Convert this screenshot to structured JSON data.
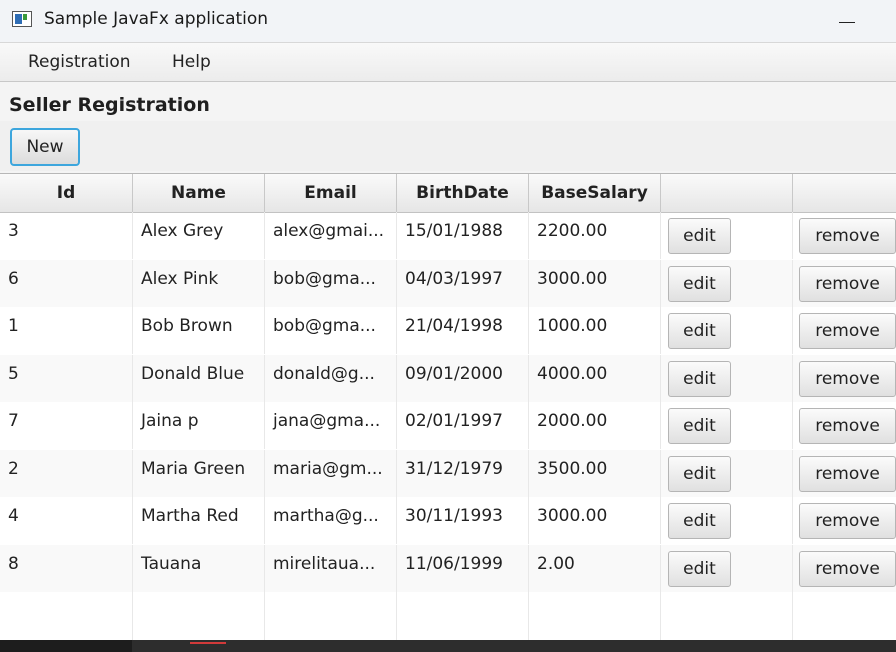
{
  "window": {
    "title": "Sample JavaFx application"
  },
  "menu": {
    "items": [
      "Registration",
      "Help"
    ]
  },
  "form": {
    "title": "Seller Registration",
    "new_label": "New"
  },
  "table": {
    "columns": [
      "Id",
      "Name",
      "Email",
      "BirthDate",
      "BaseSalary",
      "",
      ""
    ],
    "rows": [
      {
        "id": "3",
        "name": "Alex Grey",
        "email": "alex@gmai...",
        "birth": "15/01/1988",
        "salary": "2200.00",
        "edit": "edit",
        "remove": "remove"
      },
      {
        "id": "6",
        "name": "Alex Pink",
        "email": "bob@gma...",
        "birth": "04/03/1997",
        "salary": "3000.00",
        "edit": "edit",
        "remove": "remove"
      },
      {
        "id": "1",
        "name": "Bob Brown",
        "email": "bob@gma...",
        "birth": "21/04/1998",
        "salary": "1000.00",
        "edit": "edit",
        "remove": "remove"
      },
      {
        "id": "5",
        "name": "Donald Blue",
        "email": "donald@g...",
        "birth": "09/01/2000",
        "salary": "4000.00",
        "edit": "edit",
        "remove": "remove"
      },
      {
        "id": "7",
        "name": "Jaina p",
        "email": "jana@gma...",
        "birth": "02/01/1997",
        "salary": "2000.00",
        "edit": "edit",
        "remove": "remove"
      },
      {
        "id": "2",
        "name": "Maria Green",
        "email": "maria@gm...",
        "birth": "31/12/1979",
        "salary": "3500.00",
        "edit": "edit",
        "remove": "remove"
      },
      {
        "id": "4",
        "name": "Martha Red",
        "email": "martha@g...",
        "birth": "30/11/1993",
        "salary": "3000.00",
        "edit": "edit",
        "remove": "remove"
      },
      {
        "id": "8",
        "name": "Tauana",
        "email": "mirelitaua...",
        "birth": "11/06/1999",
        "salary": "2.00",
        "edit": "edit",
        "remove": "remove"
      }
    ]
  },
  "icons": {
    "app": "javafx-app-icon",
    "minimize": "minimize-icon"
  }
}
